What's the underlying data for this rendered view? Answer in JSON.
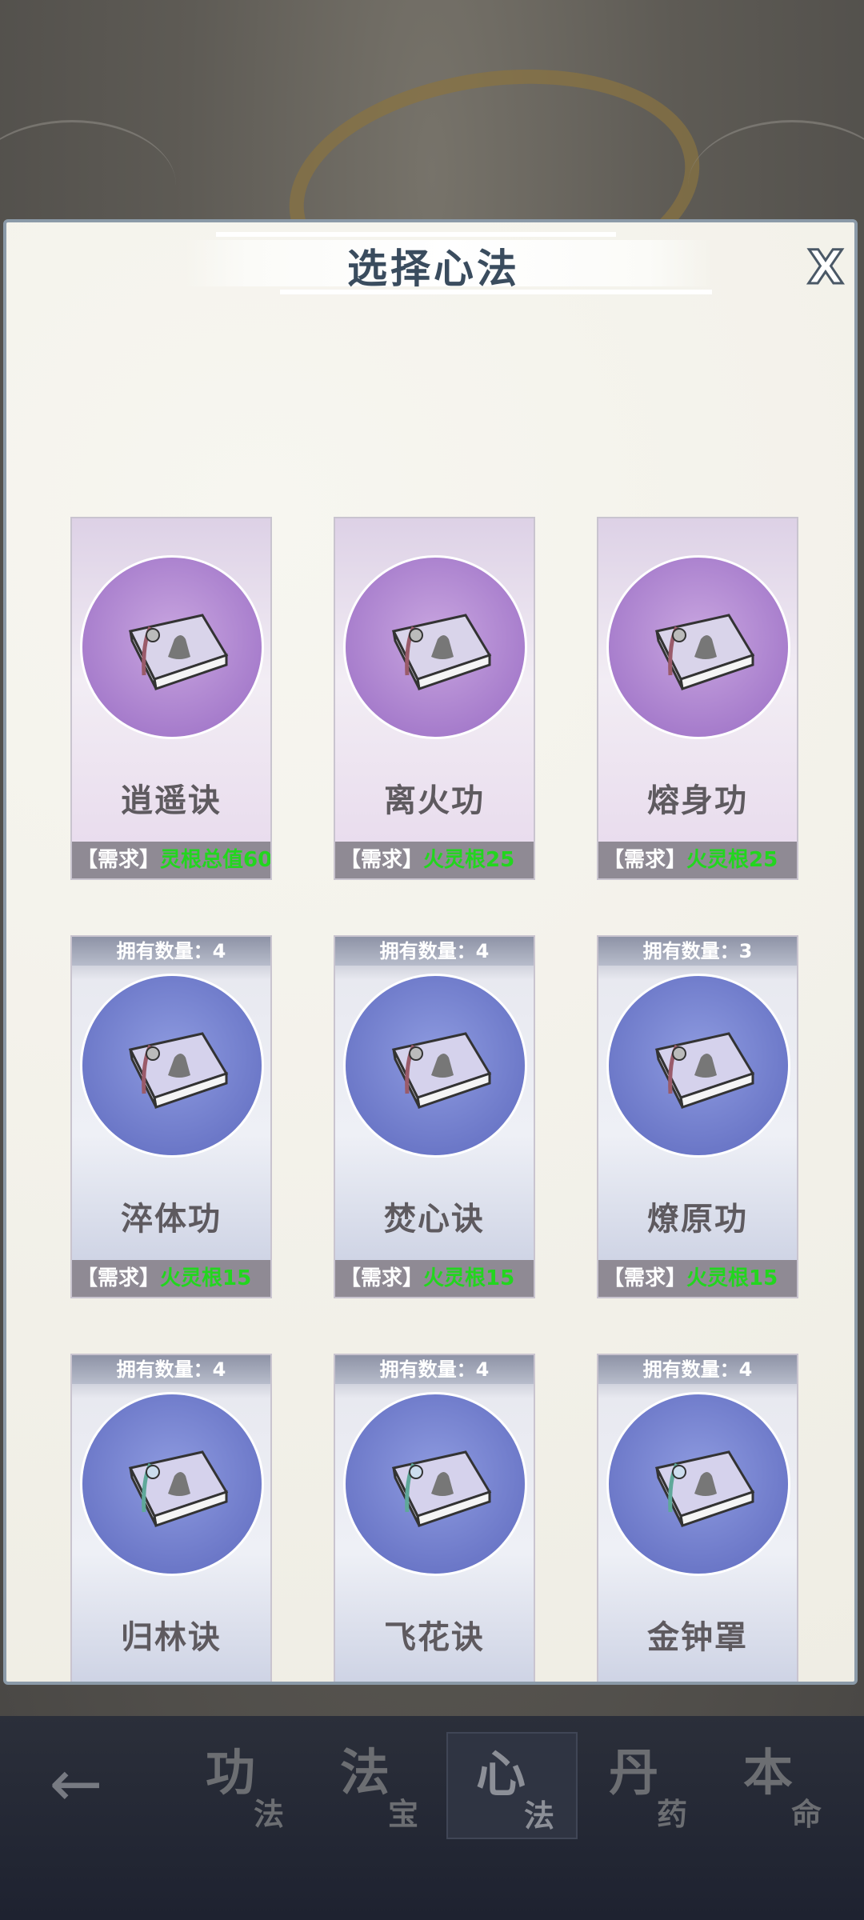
{
  "panel": {
    "title": "选择心法",
    "close_label": "X"
  },
  "cards": [
    {
      "name": "逍遥诀",
      "theme": "purple",
      "count_text": "",
      "req_prefix": "【需求】",
      "req_value": "灵根总值60",
      "book_icon": "xiaoyao-book-icon"
    },
    {
      "name": "离火功",
      "theme": "purple",
      "count_text": "",
      "req_prefix": "【需求】",
      "req_value": "火灵根25",
      "book_icon": "fire-book-icon"
    },
    {
      "name": "熔身功",
      "theme": "purple",
      "count_text": "",
      "req_prefix": "【需求】",
      "req_value": "火灵根25",
      "book_icon": "fire-book-icon"
    },
    {
      "name": "淬体功",
      "theme": "blue",
      "count_text": "拥有数量：4",
      "req_prefix": "【需求】",
      "req_value": "火灵根15",
      "book_icon": "fire-book-icon"
    },
    {
      "name": "焚心诀",
      "theme": "blue",
      "count_text": "拥有数量：4",
      "req_prefix": "【需求】",
      "req_value": "火灵根15",
      "book_icon": "fire-book-icon"
    },
    {
      "name": "燎原功",
      "theme": "blue",
      "count_text": "拥有数量：3",
      "req_prefix": "【需求】",
      "req_value": "火灵根15",
      "book_icon": "fire-book-icon"
    },
    {
      "name": "归林诀",
      "theme": "blue",
      "count_text": "拥有数量：4",
      "req_prefix": "",
      "req_value": "",
      "book_icon": "wood-book-icon"
    },
    {
      "name": "飞花诀",
      "theme": "blue",
      "count_text": "拥有数量：4",
      "req_prefix": "",
      "req_value": "",
      "book_icon": "wood-book-icon"
    },
    {
      "name": "金钟罩",
      "theme": "blue",
      "count_text": "拥有数量：4",
      "req_prefix": "",
      "req_value": "",
      "book_icon": "metal-book-icon"
    }
  ],
  "bottom_nav": {
    "back_icon": "back-arrow-icon",
    "tabs": [
      {
        "main": "功",
        "sub": "法",
        "active": false
      },
      {
        "main": "法",
        "sub": "宝",
        "active": false
      },
      {
        "main": "心",
        "sub": "法",
        "active": true
      },
      {
        "main": "丹",
        "sub": "药",
        "active": false
      },
      {
        "main": "本",
        "sub": "命",
        "active": false
      }
    ]
  },
  "colors": {
    "requirement_value": "#22d61e",
    "panel_title": "#3a4c5e"
  }
}
